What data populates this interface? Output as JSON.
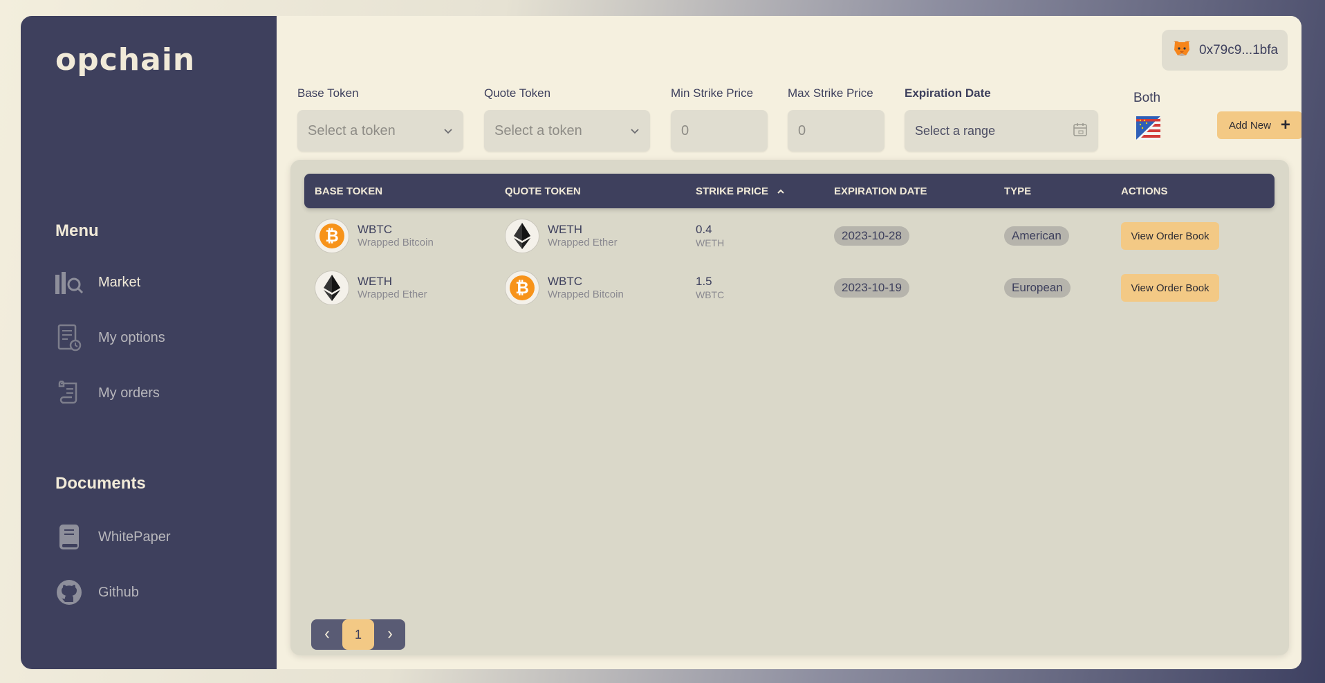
{
  "sidebar": {
    "logo": "opchain",
    "menu_title": "Menu",
    "menu_items": [
      {
        "label": "Market",
        "icon": "market-chart-icon"
      },
      {
        "label": "My options",
        "icon": "document-clock-icon"
      },
      {
        "label": "My orders",
        "icon": "scroll-icon"
      }
    ],
    "documents_title": "Documents",
    "doc_items": [
      {
        "label": "WhitePaper",
        "icon": "book-icon"
      },
      {
        "label": "Github",
        "icon": "github-icon"
      }
    ]
  },
  "wallet": {
    "address": "0x79c9...1bfa",
    "icon": "metamask-fox-icon"
  },
  "filters": {
    "base_token": {
      "label": "Base Token",
      "placeholder": "Select a token"
    },
    "quote_token": {
      "label": "Quote Token",
      "placeholder": "Select a token"
    },
    "min_strike": {
      "label": "Min Strike Price",
      "value": "0"
    },
    "max_strike": {
      "label": "Max Strike Price",
      "value": "0"
    },
    "expiration": {
      "label": "Expiration Date",
      "placeholder": "Select a range"
    },
    "option_type": {
      "label": "Both",
      "icon": "eu-us-flag-icon"
    },
    "add_new": {
      "label": "Add New",
      "icon": "plus-icon"
    }
  },
  "table": {
    "headers": {
      "base": "BASE TOKEN",
      "quote": "QUOTE TOKEN",
      "strike": "STRIKE PRICE",
      "expiration": "EXPIRATION DATE",
      "type": "TYPE",
      "actions": "ACTIONS"
    },
    "rows": [
      {
        "base": {
          "symbol": "WBTC",
          "name": "Wrapped Bitcoin"
        },
        "quote": {
          "symbol": "WETH",
          "name": "Wrapped Ether"
        },
        "strike": {
          "value": "0.4",
          "unit": "WETH"
        },
        "expiration": "2023-10-28",
        "type": "American",
        "action": "View Order Book"
      },
      {
        "base": {
          "symbol": "WETH",
          "name": "Wrapped Ether"
        },
        "quote": {
          "symbol": "WBTC",
          "name": "Wrapped Bitcoin"
        },
        "strike": {
          "value": "1.5",
          "unit": "WBTC"
        },
        "expiration": "2023-10-19",
        "type": "European",
        "action": "View Order Book"
      }
    ]
  },
  "pagination": {
    "current": "1"
  },
  "colors": {
    "sidebar_bg": "#3e405d",
    "page_bg": "#f5f0df",
    "panel_bg": "#dad8c9",
    "accent": "#f3c985",
    "bitcoin": "#f7931a"
  }
}
